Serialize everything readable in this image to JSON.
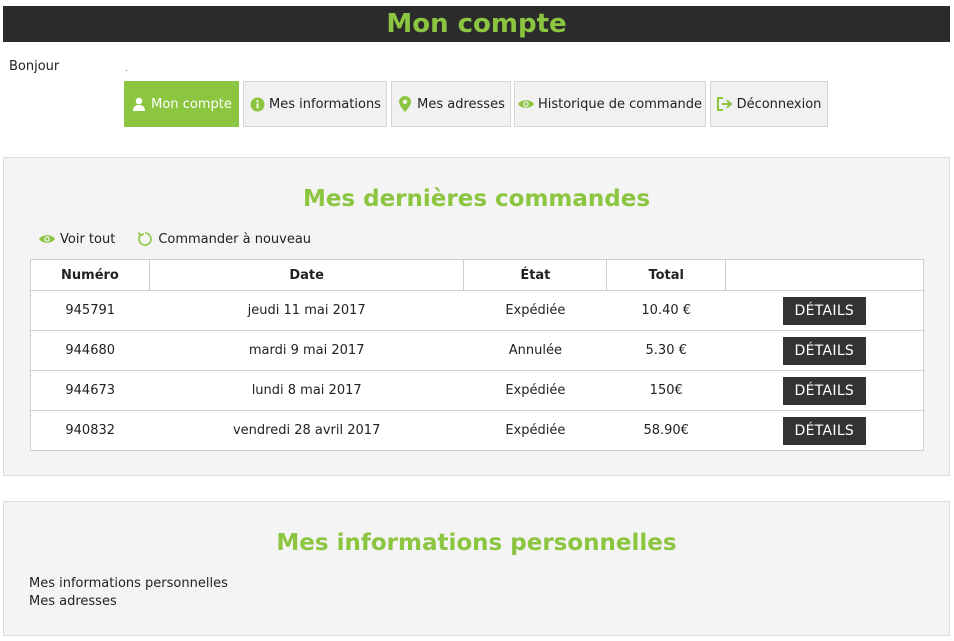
{
  "header": {
    "title": "Mon compte"
  },
  "greeting": "Bonjour",
  "greeting_dot": ".",
  "nav": [
    {
      "label": "Mon compte",
      "icon": "user-icon",
      "active": true
    },
    {
      "label": "Mes informations",
      "icon": "info-icon",
      "active": false
    },
    {
      "label": "Mes adresses",
      "icon": "map-pin-icon",
      "active": false
    },
    {
      "label": "Historique de commande",
      "icon": "eye-icon",
      "active": false
    },
    {
      "label": "Déconnexion",
      "icon": "logout-icon",
      "active": false
    }
  ],
  "orders": {
    "title": "Mes dernières commandes",
    "actions": {
      "view_all": {
        "label": "Voir tout",
        "icon": "eye-icon"
      },
      "reorder": {
        "label": "Commander à nouveau",
        "icon": "refresh-icon"
      }
    },
    "columns": [
      "Numéro",
      "Date",
      "État",
      "Total",
      ""
    ],
    "rows": [
      {
        "number": "945791",
        "date": "jeudi 11 mai 2017",
        "state": "Expédiée",
        "total": "10.40 €",
        "action": "DÉTAILS"
      },
      {
        "number": "944680",
        "date": "mardi 9 mai 2017",
        "state": "Annulée",
        "total": "5.30 €",
        "action": "DÉTAILS"
      },
      {
        "number": "944673",
        "date": "lundi 8 mai 2017",
        "state": "Expédiée",
        "total": "150€",
        "action": "DÉTAILS"
      },
      {
        "number": "940832",
        "date": "vendredi 28 avril 2017",
        "state": "Expédiée",
        "total": "58.90€",
        "action": "DÉTAILS"
      }
    ]
  },
  "personal_info": {
    "title": "Mes informations personnelles",
    "links": [
      "Mes informations personnelles",
      "Mes adresses"
    ]
  },
  "colors": {
    "accent": "#8cc540",
    "header_bg": "#2b2b2b",
    "button_bg": "#333333",
    "panel_bg": "#f4f4f4"
  }
}
